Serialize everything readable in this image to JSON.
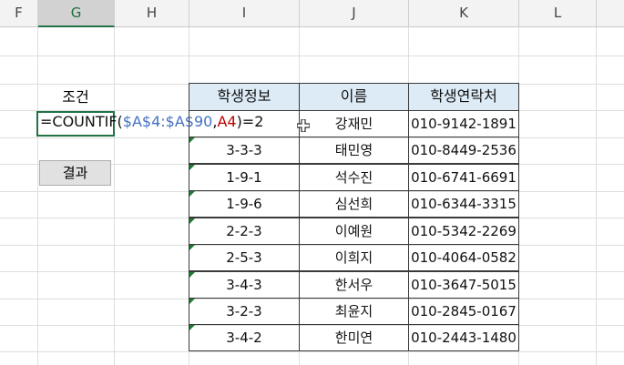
{
  "column_headers": [
    "F",
    "G",
    "H",
    "I",
    "J",
    "K",
    "L"
  ],
  "selected_column": "G",
  "condition_label": "조건",
  "formula": {
    "prefix": "=COUNTIF(",
    "range": "$A$4:$A$90",
    "sep": ",",
    "ref": "A4",
    "suffix": ")=2"
  },
  "button_label": "결과",
  "table": {
    "headers": [
      "학생정보",
      "이름",
      "학생연락처"
    ],
    "rows": [
      {
        "info": "",
        "name": "강재민",
        "phone": "010-9142-1891"
      },
      {
        "info": "3-3-3",
        "name": "태민영",
        "phone": "010-8449-2536"
      },
      {
        "info": "1-9-1",
        "name": "석수진",
        "phone": "010-6741-6691"
      },
      {
        "info": "1-9-6",
        "name": "심선희",
        "phone": "010-6344-3315"
      },
      {
        "info": "2-2-3",
        "name": "이예원",
        "phone": "010-5342-2269"
      },
      {
        "info": "2-5-3",
        "name": "이희지",
        "phone": "010-4064-0582"
      },
      {
        "info": "3-4-3",
        "name": "한서우",
        "phone": "010-3647-5015"
      },
      {
        "info": "3-2-3",
        "name": "최윤지",
        "phone": "010-2845-0167"
      },
      {
        "info": "3-4-2",
        "name": "한미연",
        "phone": "010-2443-1480"
      }
    ]
  },
  "colors": {
    "header_fill": "#ddebf7",
    "selection": "#217346",
    "range_ref": "#4472c4",
    "cell_ref": "#c00000"
  }
}
